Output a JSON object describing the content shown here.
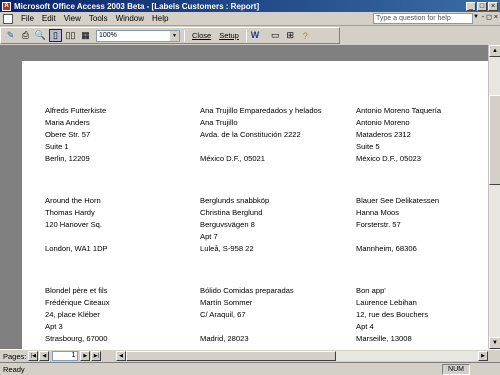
{
  "window": {
    "title": "Microsoft Office Access 2003 Beta - [Labels Customers : Report]",
    "icon": "access-app-icon"
  },
  "menu": {
    "items": [
      "File",
      "Edit",
      "View",
      "Tools",
      "Window",
      "Help"
    ],
    "ask_placeholder": "Type a question for help"
  },
  "toolbar": {
    "zoom": "100%",
    "close_label": "Close",
    "setup_label": "Setup"
  },
  "report": {
    "labels": [
      [
        "Alfreds Futterkiste",
        "Maria Anders",
        "Obere Str. 57",
        "Suite 1",
        "Berlin,  12209"
      ],
      [
        "Ana Trujillo Emparedados y helados",
        "Ana Trujillo",
        "Avda. de la Constitución 2222",
        "",
        "México D.F.,  05021"
      ],
      [
        "Antonio Moreno Taquería",
        "Antonio Moreno",
        "Mataderos  2312",
        "Suite 5",
        "México D.F.,  05023"
      ],
      [
        "Around the Horn",
        "Thomas Hardy",
        "120 Hanover Sq.",
        "",
        "London,  WA1 1DP"
      ],
      [
        "Berglunds snabbköp",
        "Christina Berglund",
        "Berguvsvägen  8",
        "Apt 7",
        "Luleå,  S-958 22"
      ],
      [
        "Blauer See Delikatessen",
        "Hanna Moos",
        "Forsterstr. 57",
        "",
        "Mannheim,  68306"
      ],
      [
        "Blondel père et fils",
        "Frédérique Citeaux",
        "24, place Kléber",
        "Apt 3",
        "Strasbourg,  67000"
      ],
      [
        "Bólido Comidas preparadas",
        "Martín Sommer",
        "C/ Araquil, 67",
        "",
        "Madrid,  28023"
      ],
      [
        "Bon app'",
        "Laurence Lebihan",
        "12, rue des Bouchers",
        "Apt 4",
        "Marseille,  13008"
      ]
    ]
  },
  "navigation": {
    "pages_label": "Pages:",
    "current_page": "1"
  },
  "status": {
    "text": "Ready",
    "num": "NUM"
  }
}
